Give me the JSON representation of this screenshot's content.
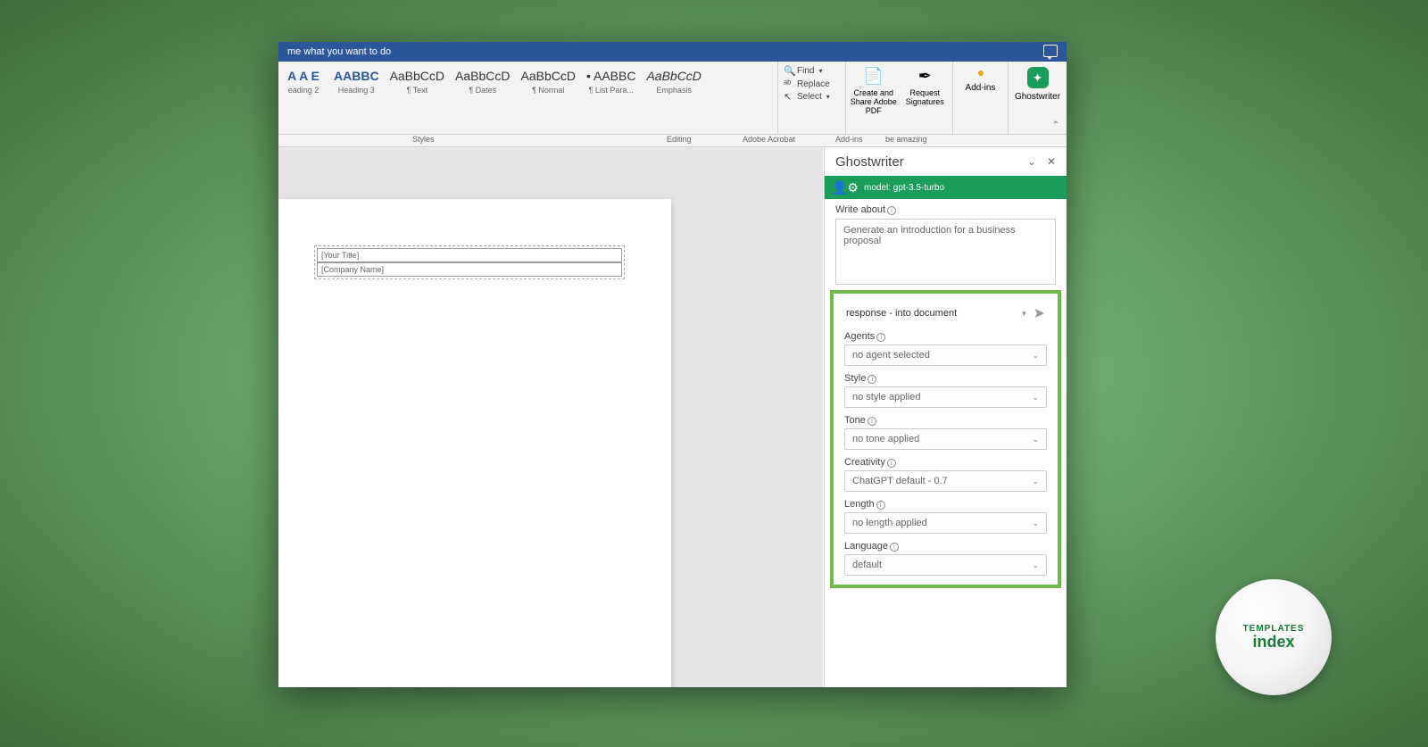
{
  "titlebar": {
    "tellme": "me what you want to do"
  },
  "ribbon": {
    "styles": [
      {
        "preview": "A A E",
        "name": "eading 2",
        "cls": "bold"
      },
      {
        "preview": "AABBC",
        "name": "Heading 3",
        "cls": "bold"
      },
      {
        "preview": "AaBbCcD",
        "name": "¶ Text",
        "cls": "dark"
      },
      {
        "preview": "AaBbCcD",
        "name": "¶ Dates",
        "cls": "dark"
      },
      {
        "preview": "AaBbCcD",
        "name": "¶ Normal",
        "cls": "dark"
      },
      {
        "preview": "• AABBC",
        "name": "¶ List Para...",
        "cls": "dark"
      },
      {
        "preview": "AaBbCcD",
        "name": "Emphasis",
        "cls": "dark"
      }
    ],
    "editing": {
      "find": "Find",
      "replace": "Replace",
      "select": "Select"
    },
    "acrobat": {
      "create": "Create and Share Adobe PDF",
      "request": "Request Signatures"
    },
    "addins": "Add-ins",
    "ghostwriter": "Ghostwriter",
    "groups": {
      "styles": "Styles",
      "editing": "Editing",
      "acrobat": "Adobe Acrobat",
      "addins": "Add-ins",
      "beamazing": "be amazing"
    }
  },
  "document": {
    "field1": "[Your Title]",
    "field2": "[Company Name]"
  },
  "panel": {
    "title": "Ghostwriter",
    "model": "model: gpt-3.5-turbo",
    "write_about": "Write about",
    "prompt": "Generate an introduction for a business proposal",
    "response": "response - into document",
    "options": {
      "agents": {
        "label": "Agents",
        "value": "no agent selected"
      },
      "style": {
        "label": "Style",
        "value": "no style applied"
      },
      "tone": {
        "label": "Tone",
        "value": "no tone applied"
      },
      "creativity": {
        "label": "Creativity",
        "value": "ChatGPT default - 0.7"
      },
      "length": {
        "label": "Length",
        "value": "no length applied"
      },
      "language": {
        "label": "Language",
        "value": "default"
      }
    }
  },
  "logo": {
    "top": "TEMPLATES",
    "bottom": "index"
  }
}
